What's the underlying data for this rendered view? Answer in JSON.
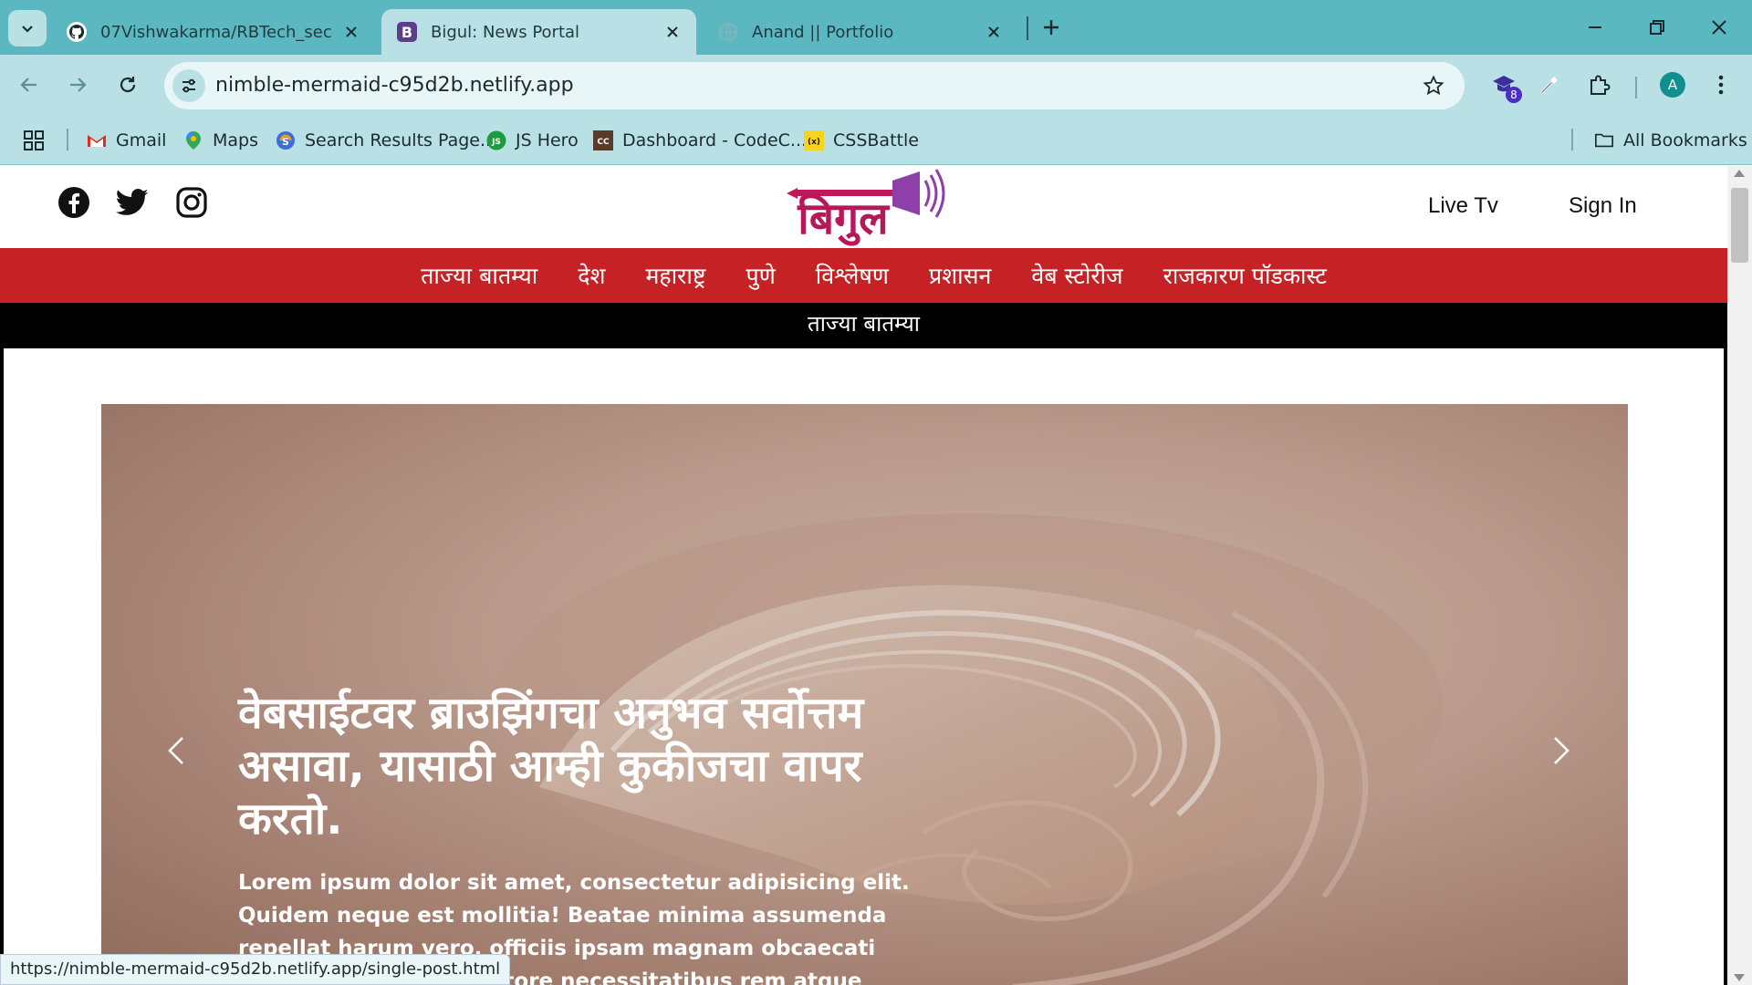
{
  "browser": {
    "tabs": [
      {
        "title": "07Vishwakarma/RBTech_second",
        "favicon": "github-icon",
        "active": false
      },
      {
        "title": "Bigul: News Portal",
        "favicon": "bootstrap-b-icon",
        "active": true
      },
      {
        "title": "Anand || Portfolio",
        "favicon": "globe-icon",
        "active": false
      }
    ],
    "url": "nimble-mermaid-c95d2b.netlify.app",
    "extension_badge": "8",
    "profile_initial": "A",
    "bookmarks": [
      {
        "label": "Gmail",
        "icon": "gmail-icon"
      },
      {
        "label": "Maps",
        "icon": "maps-pin-icon"
      },
      {
        "label": "Search Results Page...",
        "icon": "search-results-icon"
      },
      {
        "label": "JS Hero",
        "icon": "js-hero-icon"
      },
      {
        "label": "Dashboard - CodeC...",
        "icon": "codechef-icon"
      },
      {
        "label": "CSSBattle",
        "icon": "cssbattle-icon"
      }
    ],
    "all_bookmarks": "All Bookmarks",
    "status_url": "https://nimble-mermaid-c95d2b.netlify.app/single-post.html",
    "colors": {
      "frame": "#5bb8c1",
      "toolbar": "#b9e1e5"
    }
  },
  "site": {
    "logo_text": "बिगुल",
    "header_links": {
      "live_tv": "Live Tv",
      "sign_in": "Sign In"
    },
    "social": [
      "facebook-icon",
      "twitter-icon",
      "instagram-icon"
    ],
    "nav": [
      "ताज्या बातम्या",
      "देश",
      "महाराष्ट्र",
      "पुणे",
      "विश्लेषण",
      "प्रशासन",
      "वेब स्टोरीज",
      "राजकारण पॉडकास्ट"
    ],
    "section_title": "ताज्या बातम्या",
    "hero": {
      "title": "वेबसाईटवर ब्राउझिंगचा अनुभव सर्वोत्तम असावा, यासाठी आम्ही कुकीजचा वापर करतो.",
      "text": "Lorem ipsum dolor sit amet, consectetur adipisicing elit. Quidem neque est mollitia! Beatae minima assumenda repellat harum vero, officiis ipsam magnam obcaecati cumque maxime inventore necessitatibus rem atque"
    },
    "colors": {
      "nav": "#c62124",
      "logo_pink": "#c2185b",
      "logo_purple": "#5e35b1"
    }
  }
}
